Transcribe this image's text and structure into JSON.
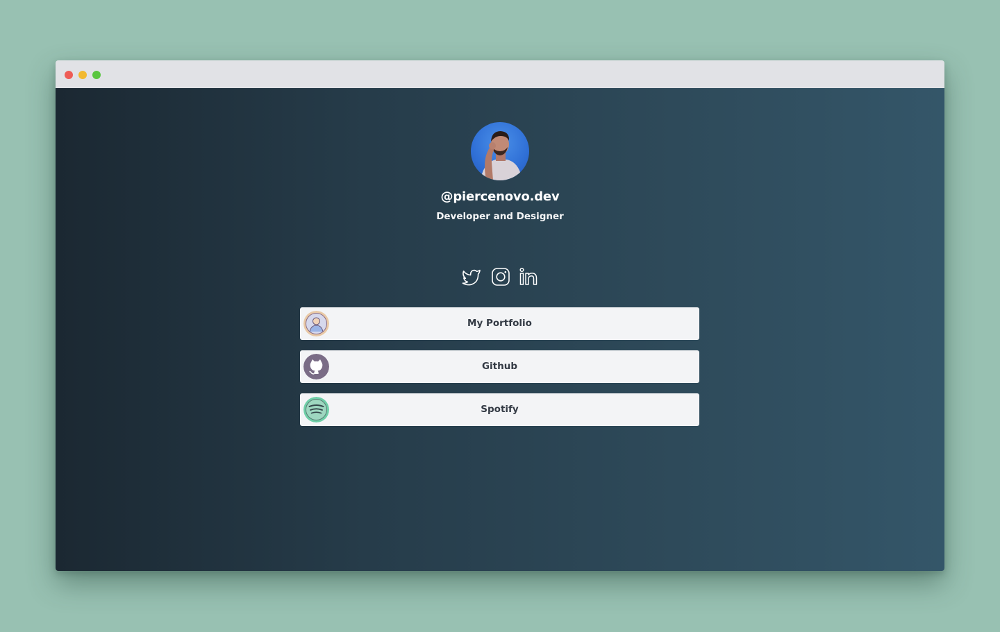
{
  "window": {
    "controls": [
      "close",
      "minimize",
      "maximize"
    ]
  },
  "profile": {
    "username": "@piercenovo.dev",
    "tagline": "Developer and Designer",
    "avatar_icon": "profile-photo"
  },
  "socials": [
    {
      "name": "twitter",
      "icon": "twitter-icon"
    },
    {
      "name": "instagram",
      "icon": "instagram-icon"
    },
    {
      "name": "linkedin",
      "icon": "linkedin-icon"
    }
  ],
  "links": [
    {
      "label": "My Portfolio",
      "icon": "portfolio-avatar-icon"
    },
    {
      "label": "Github",
      "icon": "github-icon"
    },
    {
      "label": "Spotify",
      "icon": "spotify-icon"
    }
  ],
  "colors": {
    "page_background": "#98c1b2",
    "titlebar": "#e1e2e6",
    "gradient_start": "#1b2832",
    "gradient_end": "#345669",
    "card_background": "#f3f4f6",
    "card_text": "#333a44",
    "close": "#ee5c56",
    "minimize": "#f2b930",
    "maximize": "#5ac640"
  }
}
